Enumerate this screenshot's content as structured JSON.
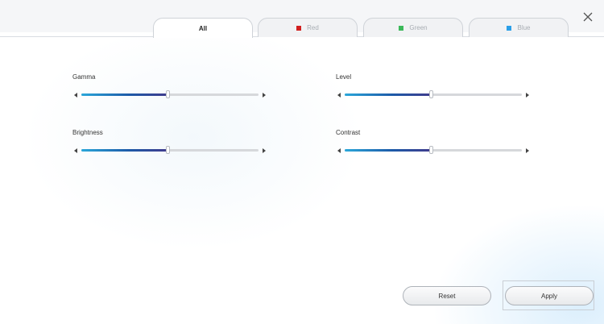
{
  "tabs": [
    {
      "label": "All",
      "active": true,
      "swatch": null
    },
    {
      "label": "Red",
      "active": false,
      "swatch": "#d11f1f"
    },
    {
      "label": "Green",
      "active": false,
      "swatch": "#3cb95a"
    },
    {
      "label": "Blue",
      "active": false,
      "swatch": "#2b9fe8"
    }
  ],
  "sliders": {
    "gamma": {
      "label": "Gamma",
      "value": 0.49
    },
    "level": {
      "label": "Level",
      "value": 0.49
    },
    "brightness": {
      "label": "Brightness",
      "value": 0.49
    },
    "contrast": {
      "label": "Contrast",
      "value": 0.49
    }
  },
  "buttons": {
    "reset": "Reset",
    "apply": "Apply"
  },
  "icons": {
    "close": "close-icon",
    "left_arrow": "triangle-left-icon",
    "right_arrow": "triangle-right-icon"
  }
}
